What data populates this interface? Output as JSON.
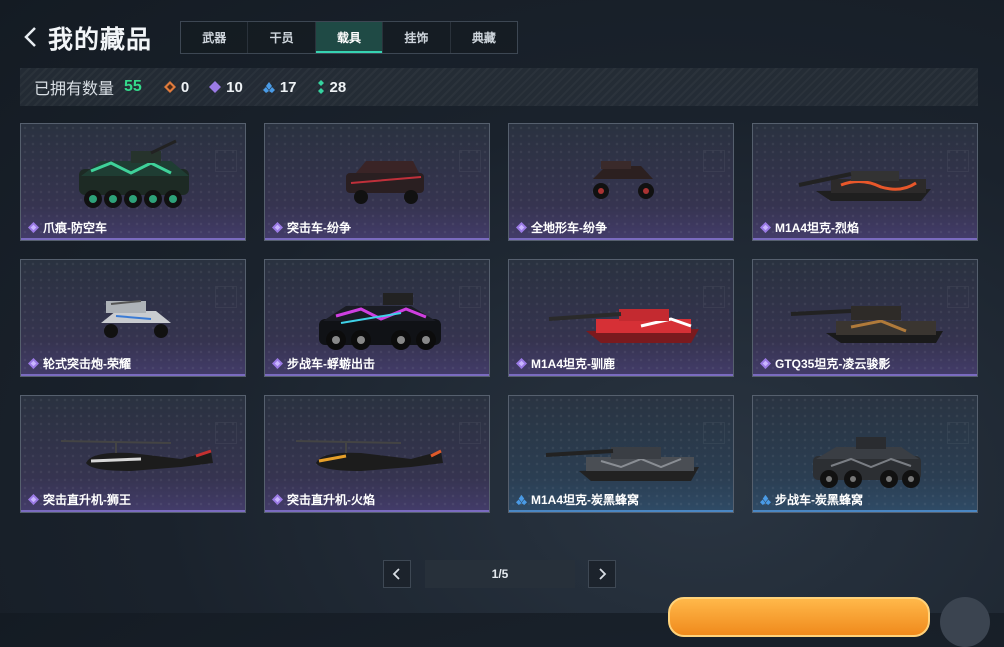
{
  "header": {
    "title": "我的藏品",
    "tabs": [
      {
        "label": "武器",
        "active": false
      },
      {
        "label": "干员",
        "active": false
      },
      {
        "label": "载具",
        "active": true
      },
      {
        "label": "挂饰",
        "active": false
      },
      {
        "label": "典藏",
        "active": false
      }
    ]
  },
  "stats": {
    "owned_label": "已拥有数量",
    "owned_total": "55",
    "orange_count": "0",
    "purple_count": "10",
    "blue_count": "17",
    "green_count": "28",
    "colors": {
      "total": "#34d98a",
      "orange": "#e07b3c",
      "purple": "#9b7be6",
      "blue": "#4a9be6",
      "green": "#36d3a0"
    }
  },
  "vehicles": [
    {
      "name": "爪痕-防空车",
      "rarity": "purple"
    },
    {
      "name": "突击车-纷争",
      "rarity": "purple"
    },
    {
      "name": "全地形车-纷争",
      "rarity": "purple"
    },
    {
      "name": "M1A4坦克-烈焰",
      "rarity": "purple"
    },
    {
      "name": "轮式突击炮-荣耀",
      "rarity": "purple"
    },
    {
      "name": "步战车-蜉蝣出击",
      "rarity": "purple"
    },
    {
      "name": "M1A4坦克-驯鹿",
      "rarity": "purple"
    },
    {
      "name": "GTQ35坦克-凌云骏影",
      "rarity": "purple"
    },
    {
      "name": "突击直升机-狮王",
      "rarity": "purple"
    },
    {
      "name": "突击直升机-火焰",
      "rarity": "purple"
    },
    {
      "name": "M1A4坦克-炭黑蜂窝",
      "rarity": "blue"
    },
    {
      "name": "步战车-炭黑蜂窝",
      "rarity": "blue"
    }
  ],
  "pagination": {
    "text": "1/5"
  }
}
